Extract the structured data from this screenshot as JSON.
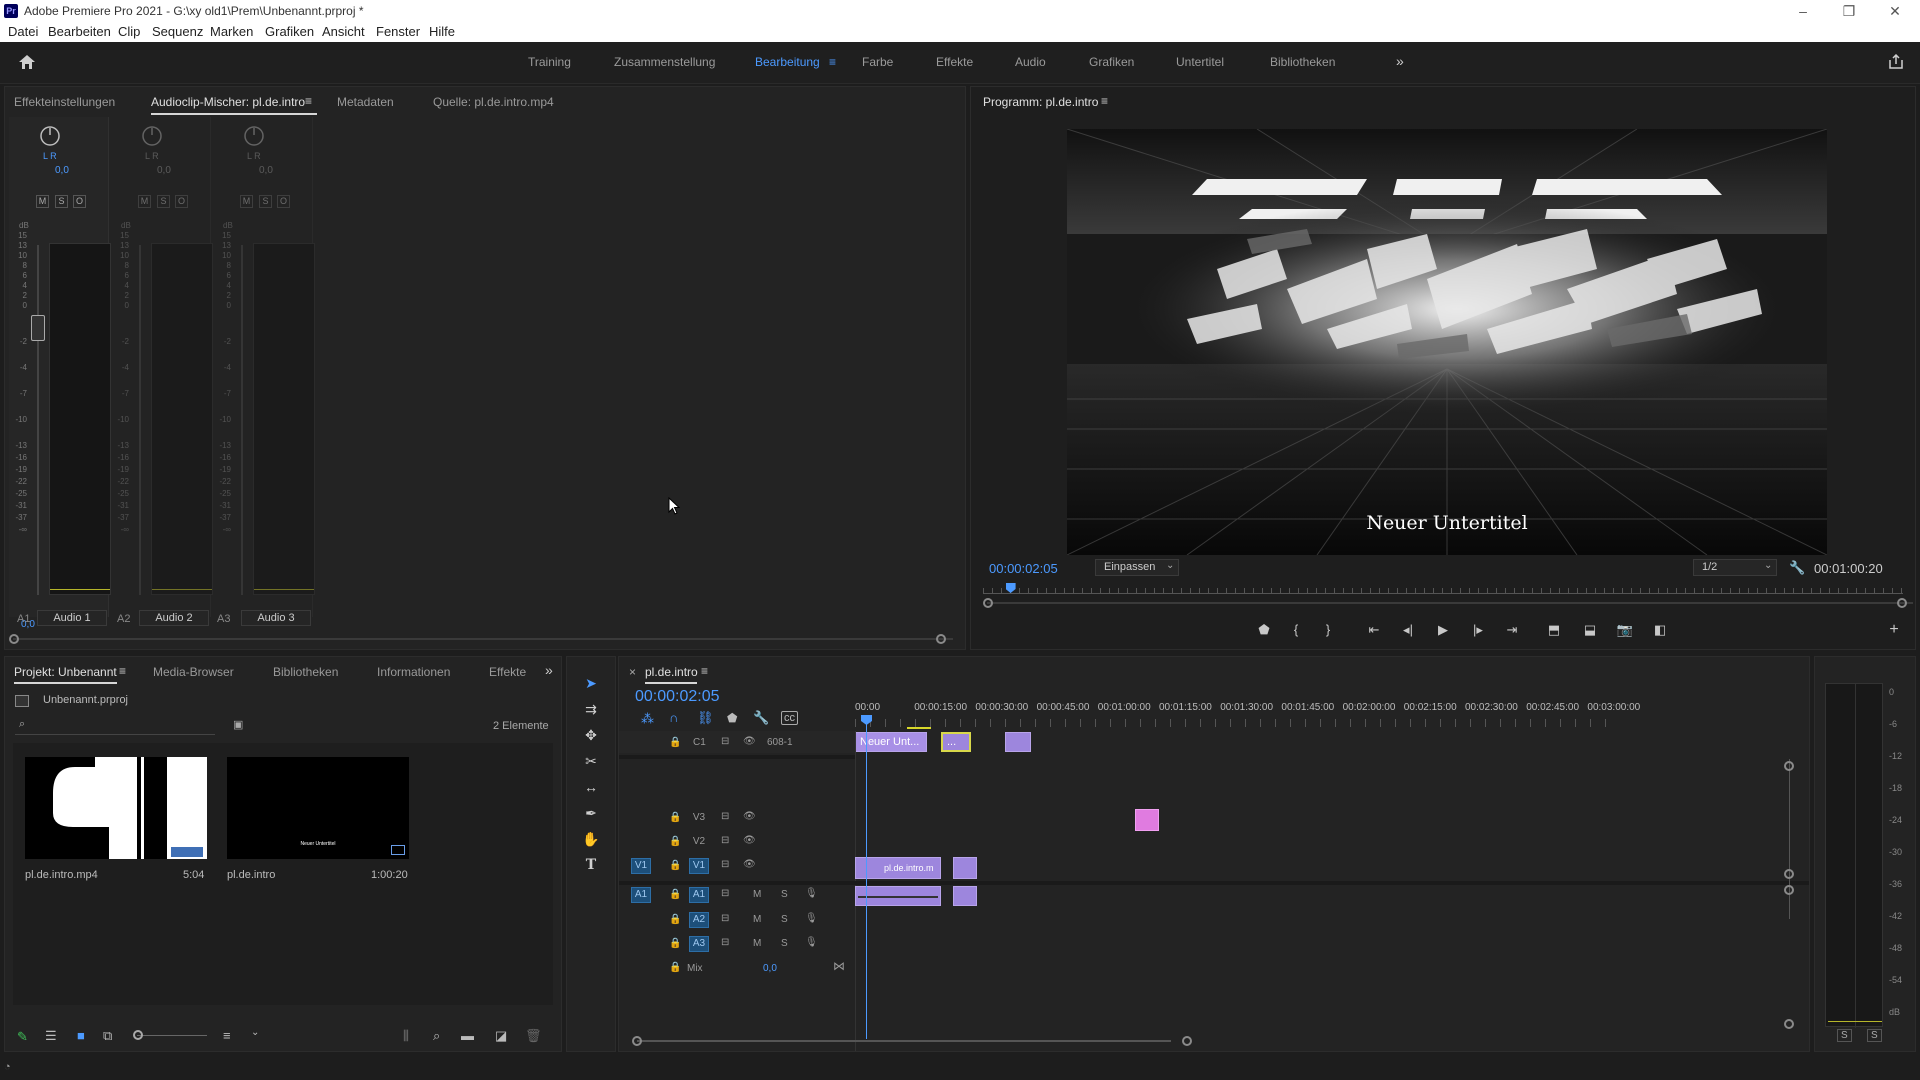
{
  "window": {
    "title": "Adobe Premiere Pro 2021 - G:\\xy old1\\Prem\\Unbenannt.prproj *",
    "app_icon": "Pr"
  },
  "menu": [
    "Datei",
    "Bearbeiten",
    "Clip",
    "Sequenz",
    "Marken",
    "Grafiken",
    "Ansicht",
    "Fenster",
    "Hilfe"
  ],
  "workspaces": {
    "tabs": [
      "Training",
      "Zusammenstellung",
      "Bearbeitung",
      "Farbe",
      "Effekte",
      "Audio",
      "Grafiken",
      "Untertitel",
      "Bibliotheken"
    ],
    "active": "Bearbeitung",
    "more": "»"
  },
  "source_panel": {
    "tabs": [
      "Effekteinstellungen",
      "Audioclip-Mischer: pl.de.intro",
      "Metadaten",
      "Quelle: pl.de.intro.mp4"
    ],
    "active_tab": "Audioclip-Mischer: pl.de.intro",
    "mixer": {
      "lr_label": "L R",
      "pan_value": "0,0",
      "db_unit": "dB",
      "buttons": [
        "M",
        "S",
        "O"
      ],
      "scale": [
        "15",
        "13",
        "10",
        "8",
        "6",
        "4",
        "2",
        "0",
        "-2",
        "-4",
        "-7",
        "-10",
        "-13",
        "-16",
        "-19",
        "-22",
        "-25",
        "-31",
        "-37",
        "-∞"
      ],
      "gain_value": "0,0",
      "channels": [
        {
          "track": "A1",
          "name": "Audio 1"
        },
        {
          "track": "A2",
          "name": "Audio 2"
        },
        {
          "track": "A3",
          "name": "Audio 3"
        }
      ]
    }
  },
  "program_monitor": {
    "title": "Programm: pl.de.intro",
    "subtitle_text": "Neuer Untertitel",
    "timecode": "00:00:02:05",
    "fit": "Einpassen",
    "resolution": "1/2",
    "duration": "00:01:00:20",
    "playhead_fraction": 0.03
  },
  "project_panel": {
    "tabs": [
      "Projekt: Unbenannt",
      "Media-Browser",
      "Bibliotheken",
      "Informationen",
      "Effekte"
    ],
    "active_tab": "Projekt: Unbenannt",
    "project_file": "Unbenannt.prproj",
    "count": "2 Elemente",
    "items": [
      {
        "name": "pl.de.intro.mp4",
        "duration": "5:04"
      },
      {
        "name": "pl.de.intro",
        "duration": "1:00:20"
      }
    ],
    "thumb_caption": "Neuer Untertitel"
  },
  "timeline": {
    "title": "pl.de.intro",
    "timecode": "00:00:02:05",
    "ruler": [
      "00:00",
      "00:00:15:00",
      "00:00:30:00",
      "00:00:45:00",
      "00:01:00:00",
      "00:01:15:00",
      "00:01:30:00",
      "00:01:45:00",
      "00:02:00:00",
      "00:02:15:00",
      "00:02:30:00",
      "00:02:45:00",
      "00:03:00:00"
    ],
    "caption_track": {
      "label": "C1",
      "format": "608-1",
      "clip_text": "Neuer Unt...",
      "clip2_text": "..."
    },
    "video_tracks": [
      "V3",
      "V2",
      "V1"
    ],
    "audio_tracks": [
      "A1",
      "A2",
      "A3"
    ],
    "source_v": "V1",
    "source_a": "A1",
    "track_buttons": {
      "mute": "M",
      "solo": "S"
    },
    "v1_clip": "pl.de.intro.m",
    "mix_label": "Mix",
    "mix_value": "0,0"
  },
  "audio_meter": {
    "scale": [
      "0",
      "-6",
      "-12",
      "-18",
      "-24",
      "-30",
      "-36",
      "-42",
      "-48",
      "-54",
      "dB"
    ],
    "solo_buttons": [
      "S",
      "S"
    ]
  }
}
